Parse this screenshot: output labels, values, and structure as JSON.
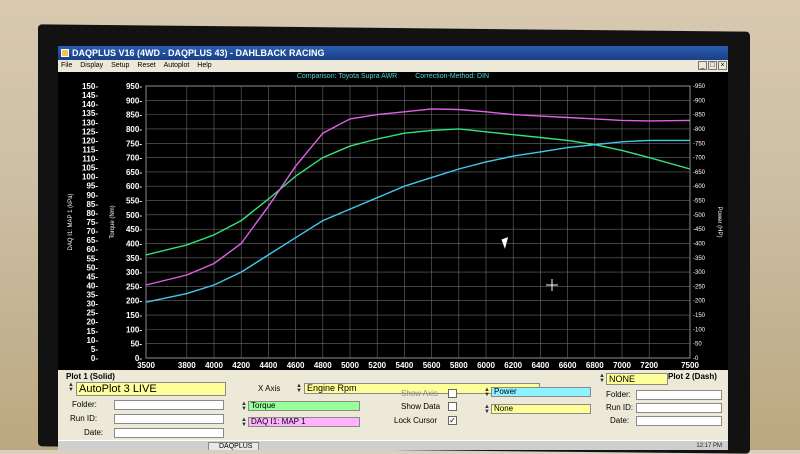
{
  "window": {
    "title": "DAQPLUS V16 (4WD - DAQPLUS 43) - DAHLBACK RACING",
    "menu": [
      "File",
      "Display",
      "Setup",
      "Reset",
      "Autoplot",
      "Help"
    ],
    "min_glyph": "_",
    "max_glyph": "□",
    "close_glyph": "×"
  },
  "caption": {
    "comparison": "Comparison: Toyota Supra AWR",
    "correction": "Correction-Method: DIN"
  },
  "chart_data": {
    "type": "line",
    "x_ticks": [
      3500,
      3800,
      4000,
      4200,
      4400,
      4600,
      4800,
      5000,
      5200,
      5400,
      5600,
      5800,
      6000,
      6200,
      6400,
      6600,
      6800,
      7000,
      7200,
      7500
    ],
    "xlim": [
      3500,
      7500
    ],
    "y_left_outer_ticks": [
      0,
      5,
      10,
      15,
      20,
      25,
      30,
      35,
      40,
      45,
      50,
      55,
      60,
      65,
      70,
      75,
      80,
      85,
      90,
      95,
      100,
      105,
      110,
      115,
      120,
      125,
      130,
      135,
      140,
      145,
      150
    ],
    "y_left_outer_label": "DAQ I1: MAP 1 (kPa)",
    "y_left_ticks": [
      0,
      50,
      100,
      150,
      200,
      250,
      300,
      350,
      400,
      450,
      500,
      550,
      600,
      650,
      700,
      750,
      800,
      850,
      900,
      950
    ],
    "y_left_label": "Torque (Nm)",
    "ylim": [
      0,
      950
    ],
    "y_right_ticks": [
      0,
      50,
      100,
      150,
      200,
      250,
      300,
      350,
      400,
      450,
      500,
      550,
      600,
      650,
      700,
      750,
      800,
      850,
      900,
      950
    ],
    "y_right_label": "Power (HP)",
    "grid": true,
    "series": [
      {
        "name": "Torque",
        "color": "#33e37a",
        "x": [
          3500,
          3800,
          4000,
          4200,
          4400,
          4600,
          4800,
          5000,
          5200,
          5400,
          5600,
          5800,
          6000,
          6200,
          6400,
          6600,
          6800,
          7000,
          7200,
          7500
        ],
        "y": [
          360,
          395,
          430,
          480,
          555,
          635,
          700,
          740,
          765,
          785,
          795,
          800,
          790,
          780,
          770,
          760,
          745,
          725,
          700,
          660
        ]
      },
      {
        "name": "DAQ I1: MAP 1",
        "color": "#e060e8",
        "x": [
          3500,
          3800,
          4000,
          4200,
          4400,
          4600,
          4800,
          5000,
          5200,
          5400,
          5600,
          5800,
          6000,
          6200,
          6400,
          6600,
          6800,
          7000,
          7200,
          7500
        ],
        "y": [
          255,
          290,
          330,
          400,
          530,
          670,
          785,
          835,
          850,
          860,
          870,
          868,
          860,
          850,
          845,
          840,
          835,
          830,
          828,
          830
        ]
      },
      {
        "name": "Power",
        "color": "#41c8f0",
        "x": [
          3500,
          3800,
          4000,
          4200,
          4400,
          4600,
          4800,
          5000,
          5200,
          5400,
          5600,
          5800,
          6000,
          6200,
          6400,
          6600,
          6800,
          7000,
          7200,
          7500
        ],
        "y": [
          195,
          225,
          255,
          300,
          360,
          420,
          480,
          520,
          560,
          600,
          630,
          660,
          685,
          705,
          720,
          735,
          745,
          755,
          760,
          760
        ]
      }
    ]
  },
  "panel": {
    "plot1_label": "Plot 1 (Solid)",
    "plot2_label": "Plot 2 (Dash)",
    "autoplot_value": "AutoPlot 3 LIVE",
    "folder_label": "Folder:",
    "runid_label": "Run ID:",
    "date_label": "Date:",
    "xaxis_label": "X Axis",
    "xaxis_value": "Engine Rpm",
    "ch1_value": "Torque",
    "ch2_value": "DAQ I1: MAP 1",
    "show_axis_label": "Show Axis",
    "show_data_label": "Show Data",
    "lock_cursor_label": "Lock Cursor",
    "lock_cursor_checked": "✓",
    "ch3_value": "Power",
    "ch4_value": "None",
    "plot2_value": "NONE",
    "colors": {
      "yellow": "#ffff99",
      "green": "#99ff99",
      "pink": "#ffb3ff",
      "cyan": "#8ef2ff"
    }
  },
  "taskbar": {
    "task_label": "DAQPLUS",
    "clock": "12:17 PM"
  }
}
